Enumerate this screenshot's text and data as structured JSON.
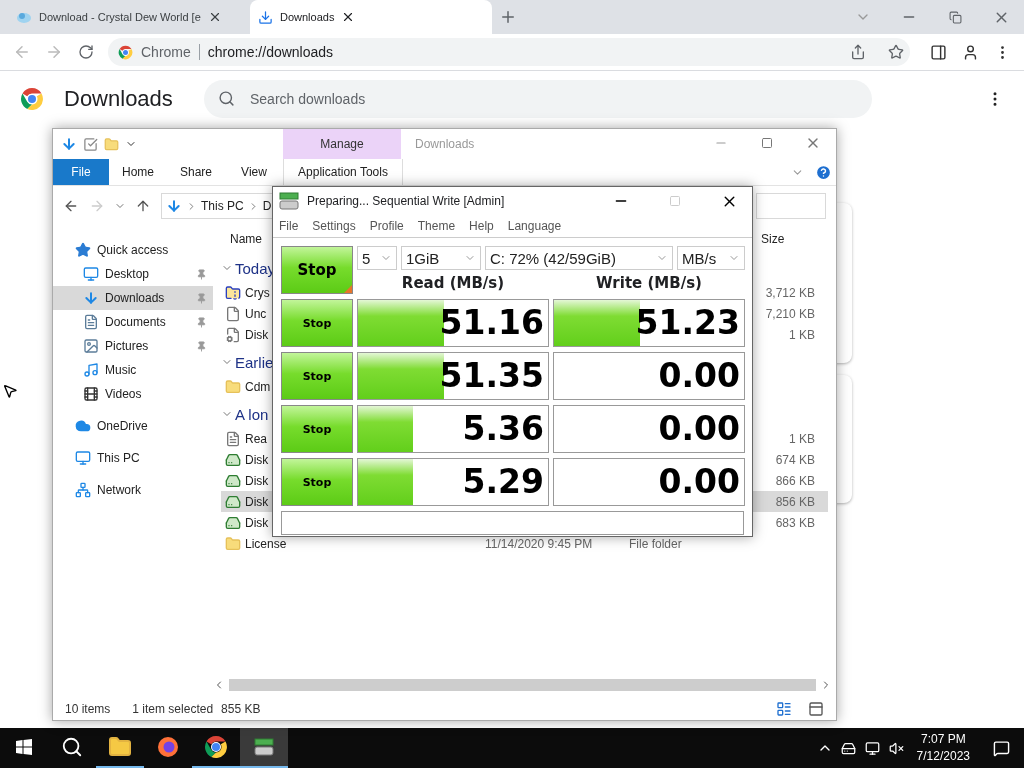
{
  "chrome": {
    "tabs": [
      {
        "title": "Download - Crystal Dew World [e",
        "kind": "site",
        "selected": false
      },
      {
        "title": "Downloads",
        "kind": "download",
        "selected": true
      }
    ],
    "address": {
      "chip": "Chrome",
      "url": "chrome://downloads"
    },
    "page_title": "Downloads",
    "search": {
      "placeholder": "Search downloads"
    }
  },
  "explorer": {
    "title": "Downloads",
    "ribbon_tabs": [
      {
        "label": "File",
        "kind": "file"
      },
      {
        "label": "Home",
        "kind": "plain"
      },
      {
        "label": "Share",
        "kind": "plain"
      },
      {
        "label": "View",
        "kind": "plain"
      },
      {
        "label": "Application Tools",
        "kind": "context",
        "group": "Manage"
      }
    ],
    "breadcrumb": [
      "This PC",
      "D"
    ],
    "sidebar": [
      {
        "label": "Quick access",
        "kind": "star",
        "selected": false,
        "children": [
          {
            "label": "Desktop",
            "kind": "desktop",
            "pinned": true,
            "selected": false
          },
          {
            "label": "Downloads",
            "kind": "download",
            "pinned": true,
            "selected": true
          },
          {
            "label": "Documents",
            "kind": "documents",
            "pinned": true,
            "selected": false
          },
          {
            "label": "Pictures",
            "kind": "pictures",
            "pinned": true,
            "selected": false
          },
          {
            "label": "Music",
            "kind": "music",
            "pinned": false,
            "selected": false
          },
          {
            "label": "Videos",
            "kind": "videos",
            "pinned": false,
            "selected": false
          }
        ]
      },
      {
        "label": "OneDrive",
        "kind": "cloud",
        "selected": false
      },
      {
        "label": "This PC",
        "kind": "pc",
        "selected": false
      },
      {
        "label": "Network",
        "kind": "network",
        "selected": false
      }
    ],
    "columns": {
      "name": "Name",
      "size": "Size"
    },
    "groups": [
      {
        "title": "Today",
        "expanded": true,
        "files": [
          {
            "name": "Crys",
            "kind": "archive",
            "size": "3,712 KB",
            "selected": false
          },
          {
            "name": "Unc",
            "kind": "blank",
            "size": "7,210 KB",
            "selected": false
          },
          {
            "name": "Disk",
            "kind": "config",
            "size": "1 KB",
            "selected": false
          }
        ]
      },
      {
        "title": "Earlie",
        "expanded": true,
        "files": [
          {
            "name": "Cdm",
            "kind": "folder",
            "selected": false
          }
        ]
      },
      {
        "title": "A lon",
        "expanded": true,
        "files": [
          {
            "name": "Rea",
            "kind": "text",
            "size": "1 KB",
            "selected": false
          },
          {
            "name": "Disk",
            "kind": "drive",
            "size": "674 KB",
            "selected": false
          },
          {
            "name": "Disk",
            "kind": "drive",
            "size": "866 KB",
            "selected": false
          },
          {
            "name": "Disk",
            "kind": "drive",
            "size": "856 KB",
            "selected": true
          },
          {
            "name": "Disk",
            "kind": "drive",
            "size": "683 KB",
            "selected": false
          },
          {
            "name": "License",
            "kind": "folder",
            "date": "11/14/2020 9:45 PM",
            "type": "File folder",
            "selected": false
          }
        ]
      }
    ],
    "status": {
      "count": "10 items",
      "selection": "1 item selected",
      "size": "855 KB"
    }
  },
  "cdm": {
    "title": "Preparing... Sequential Write [Admin]",
    "menu": [
      "File",
      "Settings",
      "Profile",
      "Theme",
      "Help",
      "Language"
    ],
    "main_button": "Stop",
    "count": "5",
    "size": "1GiB",
    "drive": "C: 72% (42/59GiB)",
    "unit": "MB/s",
    "headers": {
      "read": "Read (MB/s)",
      "write": "Write (MB/s)"
    },
    "rows": [
      {
        "button": "Stop",
        "read": {
          "value": "51.16",
          "level": 0.45
        },
        "write": {
          "value": "51.23",
          "level": 0.45
        }
      },
      {
        "button": "Stop",
        "read": {
          "value": "51.35",
          "level": 0.45
        },
        "write": {
          "value": "0.00"
        }
      },
      {
        "button": "Stop",
        "read": {
          "value": "5.36",
          "level": 0.29
        },
        "write": {
          "value": "0.00"
        }
      },
      {
        "button": "Stop",
        "read": {
          "value": "5.29",
          "level": 0.29
        },
        "write": {
          "value": "0.00"
        }
      }
    ]
  },
  "taskbar": {
    "apps": [
      {
        "kind": "explorer",
        "running": true,
        "selected": false
      },
      {
        "kind": "firefox",
        "running": false,
        "selected": false
      },
      {
        "kind": "chrome",
        "running": true,
        "selected": false
      },
      {
        "kind": "cdm",
        "running": true,
        "selected": true
      }
    ],
    "time": "7:07 PM",
    "date": "7/12/2023"
  }
}
